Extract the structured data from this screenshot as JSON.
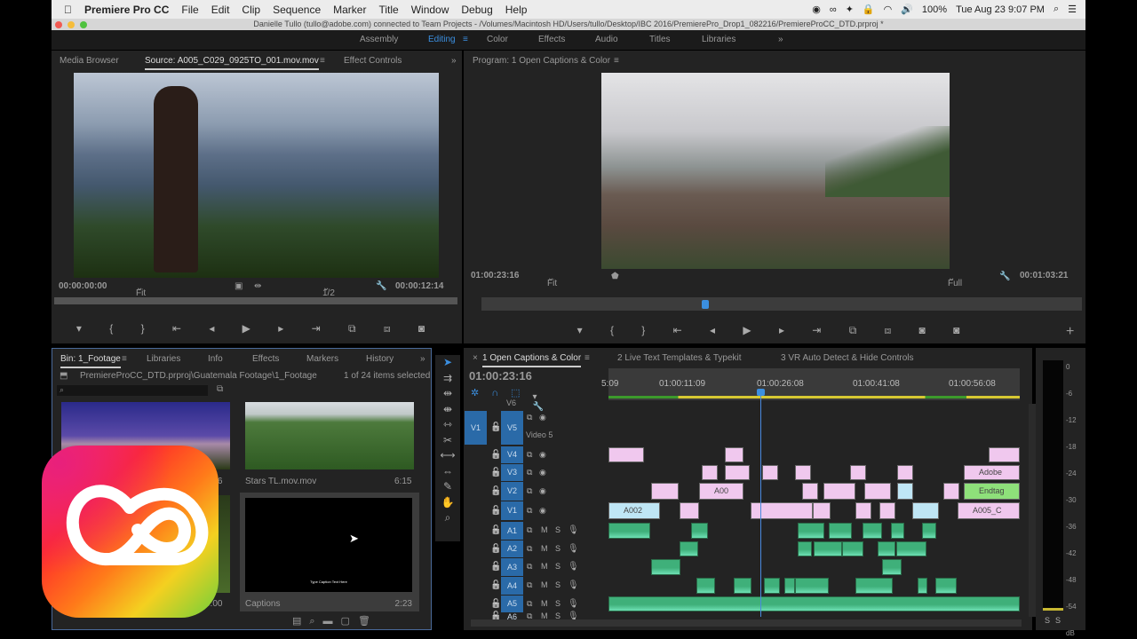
{
  "menubar": {
    "app": "Premiere Pro CC",
    "items": [
      "File",
      "Edit",
      "Clip",
      "Sequence",
      "Marker",
      "Title",
      "Window",
      "Debug",
      "Help"
    ],
    "battery": "100%",
    "clock": "Tue Aug 23  9:07 PM"
  },
  "titlebar": "Danielle Tullo (tullo@adobe.com) connected to Team Projects - /Volumes/Macintosh HD/Users/tullo/Desktop/IBC 2016/PremierePro_Drop1_082216/PremiereProCC_DTD.prproj *",
  "workspaces": [
    "Assembly",
    "Editing",
    "Color",
    "Effects",
    "Audio",
    "Titles",
    "Libraries"
  ],
  "source": {
    "tabs": [
      "Media Browser",
      "Source: A005_C029_0925TO_001.mov.mov",
      "Effect Controls"
    ],
    "timecode": "00:00:00:00",
    "fit": "Fit",
    "resolution": "1/2",
    "duration": "00:00:12:14"
  },
  "program": {
    "tab": "Program: 1 Open Captions & Color",
    "timecode": "01:00:23:16",
    "fit": "Fit",
    "resolution": "Full",
    "duration": "00:01:03:21"
  },
  "bin": {
    "tabs": [
      "Bin: 1_Footage",
      "Libraries",
      "Info",
      "Effects",
      "Markers",
      "History"
    ],
    "path": "PremiereProCC_DTD.prproj\\Guatemala Footage\\1_Footage",
    "selected": "1 of 24 items selected",
    "items": [
      {
        "name": "",
        "duration": "4:06"
      },
      {
        "name": "Stars TL.mov.mov",
        "duration": "6:15"
      },
      {
        "name": "",
        "duration": "0:00"
      },
      {
        "name": "Captions",
        "duration": "2:23",
        "caption_text": "Type Caption Text Here"
      }
    ]
  },
  "timeline": {
    "tabs": [
      "1 Open Captions & Color",
      "2 Live Text Templates & Typekit",
      "3 VR Auto Detect & Hide Controls"
    ],
    "timecode": "01:00:23:16",
    "ruler": [
      "5:09",
      "01:00:11:09",
      "01:00:26:08",
      "01:00:41:08",
      "01:00:56:08"
    ],
    "video_tracks": [
      {
        "id": "V6",
        "name": ""
      },
      {
        "id": "V5",
        "name": "Video 5",
        "source": "V1"
      },
      {
        "id": "V4"
      },
      {
        "id": "V3"
      },
      {
        "id": "V2"
      },
      {
        "id": "V1"
      }
    ],
    "audio_tracks": [
      "A1",
      "A2",
      "A3",
      "A4",
      "A5",
      "A6"
    ],
    "clip_labels": {
      "a002": "A002",
      "a00": "A00",
      "adobe": "Adobe",
      "endtag": "Endtag",
      "a005": "A005_C"
    },
    "mute": "M",
    "solo": "S"
  },
  "meter": {
    "scale": [
      "0",
      "-6",
      "-12",
      "-18",
      "-24",
      "-30",
      "-36",
      "-42",
      "-48",
      "-54",
      "dB"
    ],
    "solo": [
      "S",
      "S"
    ]
  },
  "colors": {
    "accent": "#3b8fe0",
    "video_clip": "#f0c8ee",
    "video_clip_alt": "#bfe6f5",
    "endtag": "#8ee07a",
    "audio_clip": "#3fb07a"
  }
}
